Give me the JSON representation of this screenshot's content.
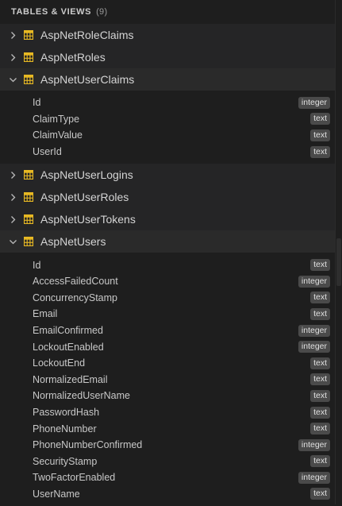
{
  "header": {
    "title": "TABLES & VIEWS",
    "count": "(9)"
  },
  "tables": [
    {
      "name": "AspNetRoleClaims",
      "expanded": false,
      "columns": []
    },
    {
      "name": "AspNetRoles",
      "expanded": false,
      "columns": []
    },
    {
      "name": "AspNetUserClaims",
      "expanded": true,
      "columns": [
        {
          "name": "Id",
          "type": "integer"
        },
        {
          "name": "ClaimType",
          "type": "text"
        },
        {
          "name": "ClaimValue",
          "type": "text"
        },
        {
          "name": "UserId",
          "type": "text"
        }
      ]
    },
    {
      "name": "AspNetUserLogins",
      "expanded": false,
      "columns": []
    },
    {
      "name": "AspNetUserRoles",
      "expanded": false,
      "columns": []
    },
    {
      "name": "AspNetUserTokens",
      "expanded": false,
      "columns": []
    },
    {
      "name": "AspNetUsers",
      "expanded": true,
      "columns": [
        {
          "name": "Id",
          "type": "text"
        },
        {
          "name": "AccessFailedCount",
          "type": "integer"
        },
        {
          "name": "ConcurrencyStamp",
          "type": "text"
        },
        {
          "name": "Email",
          "type": "text"
        },
        {
          "name": "EmailConfirmed",
          "type": "integer"
        },
        {
          "name": "LockoutEnabled",
          "type": "integer"
        },
        {
          "name": "LockoutEnd",
          "type": "text"
        },
        {
          "name": "NormalizedEmail",
          "type": "text"
        },
        {
          "name": "NormalizedUserName",
          "type": "text"
        },
        {
          "name": "PasswordHash",
          "type": "text"
        },
        {
          "name": "PhoneNumber",
          "type": "text"
        },
        {
          "name": "PhoneNumberConfirmed",
          "type": "integer"
        },
        {
          "name": "SecurityStamp",
          "type": "text"
        },
        {
          "name": "TwoFactorEnabled",
          "type": "integer"
        },
        {
          "name": "UserName",
          "type": "text"
        }
      ]
    }
  ],
  "icons": {
    "chevron": "chevron-icon",
    "table": "table-grid-icon"
  },
  "colors": {
    "table_icon": "#e8b923",
    "badge_bg": "#4a4a4a",
    "background": "#1e1e1e"
  }
}
